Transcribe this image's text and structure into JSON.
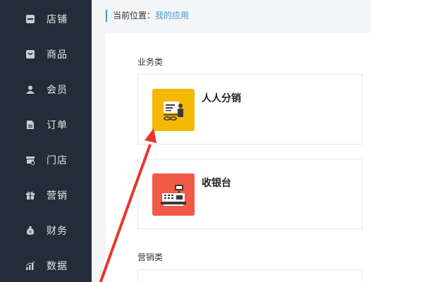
{
  "sidebar": {
    "items": [
      {
        "label": "店铺",
        "icon": "store-icon"
      },
      {
        "label": "商品",
        "icon": "goods-icon"
      },
      {
        "label": "会员",
        "icon": "member-icon"
      },
      {
        "label": "订单",
        "icon": "order-icon"
      },
      {
        "label": "门店",
        "icon": "shop-icon"
      },
      {
        "label": "营销",
        "icon": "gift-icon"
      },
      {
        "label": "财务",
        "icon": "money-bag-icon"
      },
      {
        "label": "数据",
        "icon": "chart-icon"
      }
    ]
  },
  "breadcrumb": {
    "prefix": "当前位置：",
    "current": "我的应用"
  },
  "sections": {
    "business": {
      "title": "业务类",
      "apps": [
        {
          "name": "人人分销",
          "color": "#f5b800",
          "icon": "distribution-icon"
        },
        {
          "name": "收银台",
          "color": "#f05a47",
          "icon": "cash-register-icon"
        }
      ]
    },
    "marketing": {
      "title": "营销类"
    }
  },
  "colors": {
    "sidebar_bg": "#232d39",
    "accent": "#3d97d8",
    "arrow": "#e8362b"
  }
}
